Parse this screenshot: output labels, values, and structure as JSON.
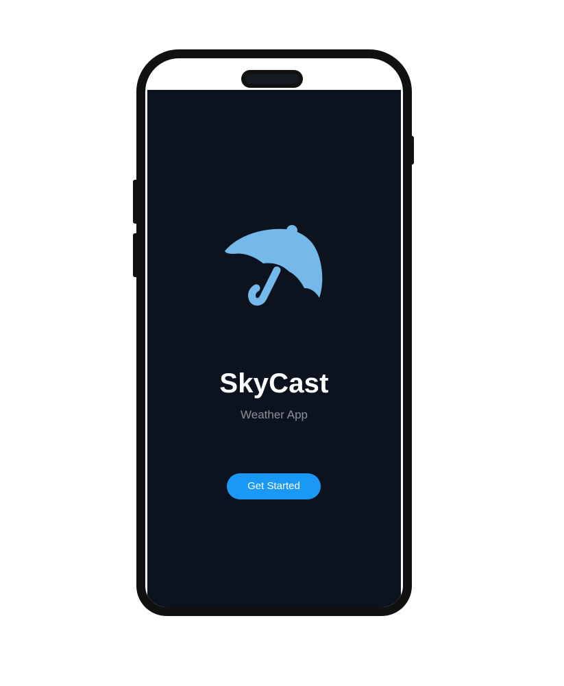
{
  "app": {
    "name": "SkyCast",
    "tagline": "Weather App",
    "cta_label": "Get Started",
    "logo_icon": "umbrella-icon"
  },
  "colors": {
    "screen_background": "#0d131e",
    "logo_color": "#75b9eb",
    "button_color": "#1a98f5",
    "title_color": "#ffffff",
    "subtitle_color": "#8b9099",
    "frame_color": "#111111"
  }
}
